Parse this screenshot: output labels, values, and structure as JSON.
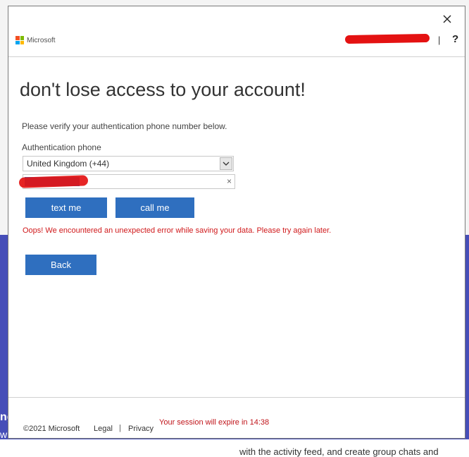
{
  "background": {
    "fragment_left_1": "ng",
    "fragment_left_2": "w",
    "fragment_bottom": "with the activity feed, and create group chats and"
  },
  "dialog": {
    "close_icon": "close-icon",
    "brand": "Microsoft",
    "header_separator": "|",
    "help_label": "?",
    "title": "don't lose access to your account!",
    "description": "Please verify your authentication phone number below.",
    "phone_label": "Authentication phone",
    "country_select_value": "United Kingdom (+44)",
    "clear_icon": "×",
    "text_button": "text me",
    "call_button": "call me",
    "error_message": "Oops! We encountered an unexpected error while saving your data. Please try again later.",
    "back_button": "Back"
  },
  "footer": {
    "copyright": "©2021 Microsoft",
    "legal": "Legal",
    "separator": "|",
    "privacy": "Privacy",
    "session_notice": "Your session will expire in 14:38"
  },
  "colors": {
    "accent": "#2f6fbf",
    "error": "#d0191b",
    "background_band": "#464eb8",
    "ms_red": "#f25022",
    "ms_green": "#7fba00",
    "ms_blue": "#00a4ef",
    "ms_yellow": "#ffb900"
  }
}
